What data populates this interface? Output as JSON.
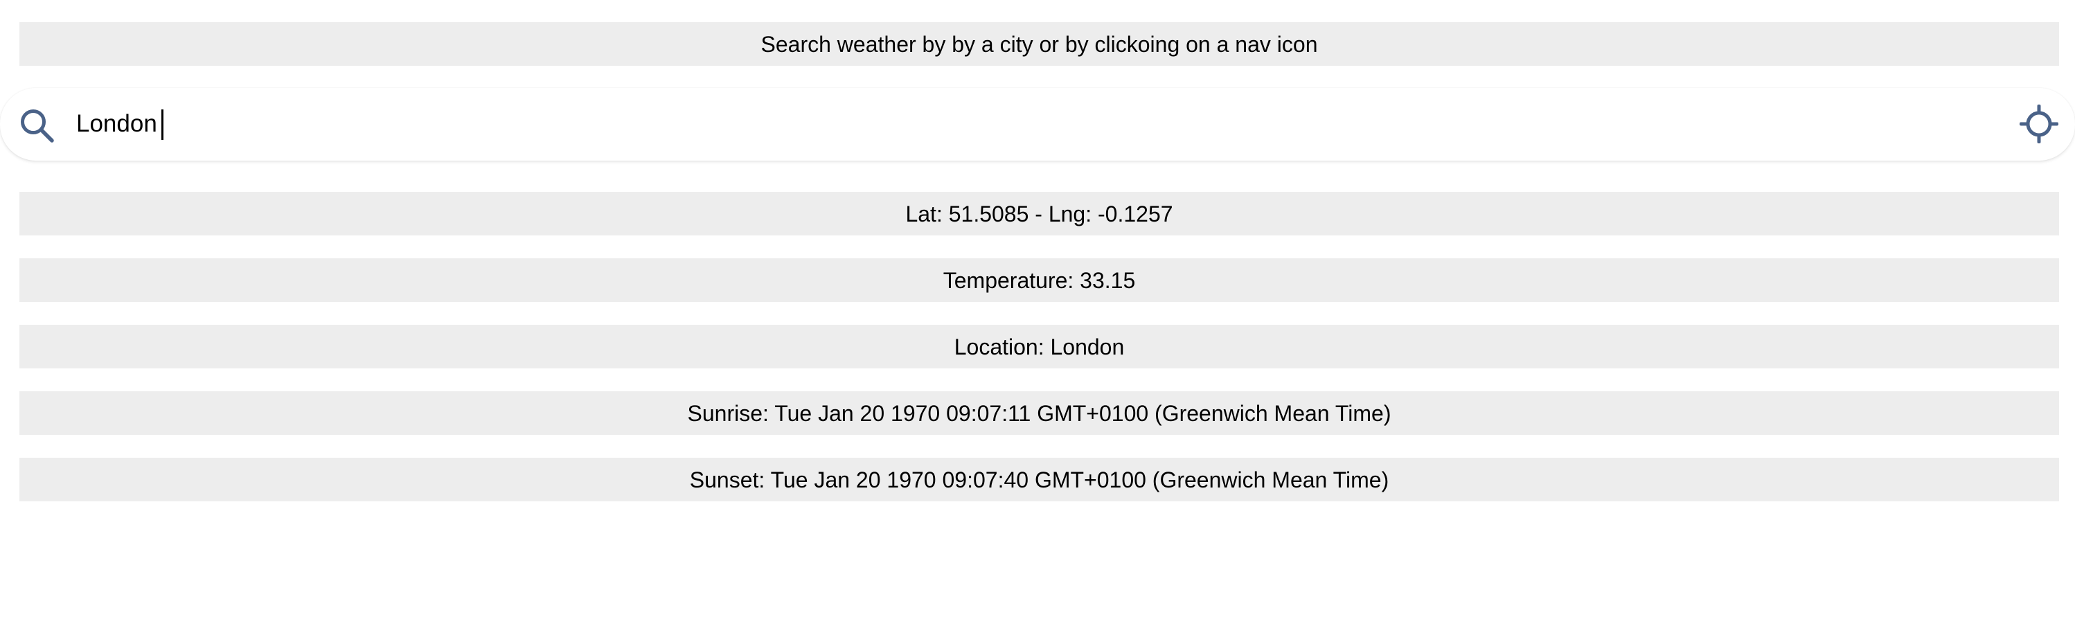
{
  "instructions": "Search weather by by a city or by clickoing on a nav icon",
  "search": {
    "value": "London",
    "search_icon": "search-icon",
    "locate_icon": "crosshair-icon",
    "icon_color": "#4a6288"
  },
  "info": {
    "latlng": "Lat: 51.5085 - Lng: -0.1257",
    "temperature": "Temperature: 33.15",
    "location": "Location: London",
    "sunrise": "Sunrise: Tue Jan 20 1970 09:07:11 GMT+0100 (Greenwich Mean Time)",
    "sunset": "Sunset: Tue Jan 20 1970 09:07:40 GMT+0100 (Greenwich Mean Time)"
  },
  "colors": {
    "panel_background": "#ededed",
    "page_background": "#ffffff"
  }
}
